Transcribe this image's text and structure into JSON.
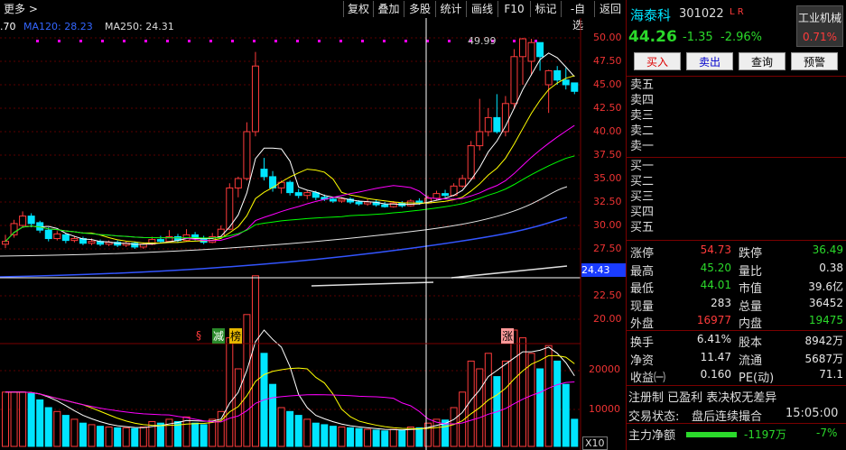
{
  "toolbar": {
    "more": "更多",
    "buttons": [
      "复权",
      "叠加",
      "多股",
      "统计",
      "画线",
      "F10",
      "标记",
      "-自选",
      "返回"
    ]
  },
  "ma_legend": {
    "ma_partial": ".70",
    "ma120": "MA120: 28.23",
    "ma250": "MA250: 24.31"
  },
  "price_axis": [
    "50.00",
    "47.50",
    "45.00",
    "42.50",
    "40.00",
    "37.50",
    "35.00",
    "32.50",
    "30.00",
    "27.50",
    "22.50",
    "20.00"
  ],
  "current_price_tag": "24.43",
  "high_marker": "49.99",
  "volume_axis": [
    "20000",
    "10000"
  ],
  "volume_unit": "X10",
  "event_markers": {
    "s": "§",
    "reduce": "减",
    "list": "榜",
    "rise": "涨"
  },
  "stock": {
    "name": "海泰科",
    "code": "301022",
    "flags": "L R",
    "price": "44.26",
    "change": "-1.35",
    "change_pct": "-2.96%",
    "industry": "工业机械",
    "industry_pct": "0.71%"
  },
  "actions": [
    "买入",
    "卖出",
    "查询",
    "预警"
  ],
  "order_book": {
    "sell": [
      "卖五",
      "卖四",
      "卖三",
      "卖二",
      "卖一"
    ],
    "buy": [
      "买一",
      "买二",
      "买三",
      "买四",
      "买五"
    ]
  },
  "quote": [
    {
      "l1": "涨停",
      "v1": "54.73",
      "c1": "red",
      "l2": "跌停",
      "v2": "36.49",
      "c2": "green"
    },
    {
      "l1": "最高",
      "v1": "45.20",
      "c1": "green",
      "l2": "量比",
      "v2": "0.38",
      "c2": "white"
    },
    {
      "l1": "最低",
      "v1": "44.01",
      "c1": "green",
      "l2": "市值",
      "v2": "39.6亿",
      "c2": "white"
    },
    {
      "l1": "现量",
      "v1": "283",
      "c1": "white",
      "l2": "总量",
      "v2": "36452",
      "c2": "white"
    },
    {
      "l1": "外盘",
      "v1": "16977",
      "c1": "red",
      "l2": "内盘",
      "v2": "19475",
      "c2": "green"
    }
  ],
  "quote2": [
    {
      "l1": "换手",
      "v1": "6.41%",
      "c1": "white",
      "l2": "股本",
      "v2": "8942万",
      "c2": "white"
    },
    {
      "l1": "净资",
      "v1": "11.47",
      "c1": "white",
      "l2": "流通",
      "v2": "5687万",
      "c2": "white"
    },
    {
      "l1": "收益㈠",
      "v1": "0.160",
      "c1": "white",
      "l2": "PE(动)",
      "v2": "71.1",
      "c2": "white"
    }
  ],
  "tags": "注册制 已盈利 表决权无差异",
  "trade_status_label": "交易状态:",
  "trade_status": "盘后连续撮合",
  "trade_time": "15:05:00",
  "main_flow_label": "主力净额",
  "main_flow_value": "-1197万",
  "main_flow_pct": "-7%",
  "colors": {
    "up": "#ff3b3b",
    "down": "#2bd92b",
    "cyan": "#00e5ff",
    "ma5": "#ffffff",
    "ma10": "#ffff00",
    "ma20": "#ff00ff",
    "ma60": "#00ff00"
  }
}
